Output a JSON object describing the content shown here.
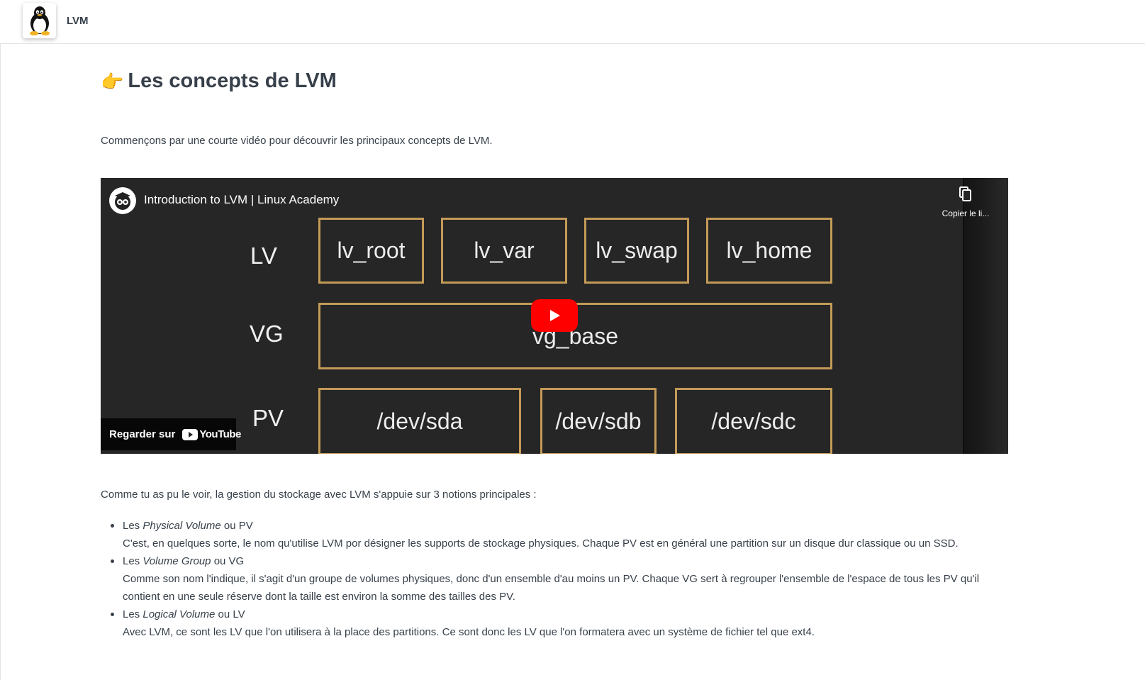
{
  "app": {
    "title": "LVM",
    "logo_icon": "tux-penguin-icon"
  },
  "section": {
    "emoji": "👉",
    "title": "Les concepts de LVM",
    "intro": "Commençons par une courte vidéo pour découvrir les principaux concepts de LVM."
  },
  "video": {
    "title": "Introduction to LVM | Linux Academy",
    "copy_label": "Copier le li...",
    "watch_on_label": "Regarder sur",
    "youtube_text": "YouTube",
    "rows": {
      "lv": "LV",
      "vg": "VG",
      "pv": "PV"
    },
    "lv_boxes": [
      "lv_root",
      "lv_var",
      "lv_swap",
      "lv_home"
    ],
    "vg_box": "vg_base",
    "pv_boxes": [
      "/dev/sda",
      "/dev/sdb",
      "/dev/sdc"
    ],
    "accent_color": "#c39a57",
    "play_color": "#ff0000"
  },
  "body": {
    "paragraph": "Comme tu as pu le voir, la gestion du stockage avec LVM s'appuie sur 3 notions principales :",
    "items": [
      {
        "prefix": "Les ",
        "term": "Physical Volume",
        "suffix": " ou PV",
        "description": "C'est, en quelques sorte, le nom qu'utilise LVM por désigner les supports de stockage physiques. Chaque PV est en général une partition sur un disque dur classique ou un SSD."
      },
      {
        "prefix": "Les ",
        "term": "Volume Group",
        "suffix": " ou VG",
        "description": "Comme son nom l'indique, il s'agit d'un groupe de volumes physiques, donc d'un ensemble d'au moins un PV. Chaque VG sert à regrouper l'ensemble de l'espace de tous les PV qu'il contient en une seule réserve dont la taille est environ la somme des tailles des PV."
      },
      {
        "prefix": "Les ",
        "term": "Logical Volume",
        "suffix": " ou LV",
        "description": "Avec LVM, ce sont les LV que l'on utilisera à la place des partitions. Ce sont donc les LV que l'on formatera avec un système de fichier tel que ext4."
      }
    ]
  }
}
